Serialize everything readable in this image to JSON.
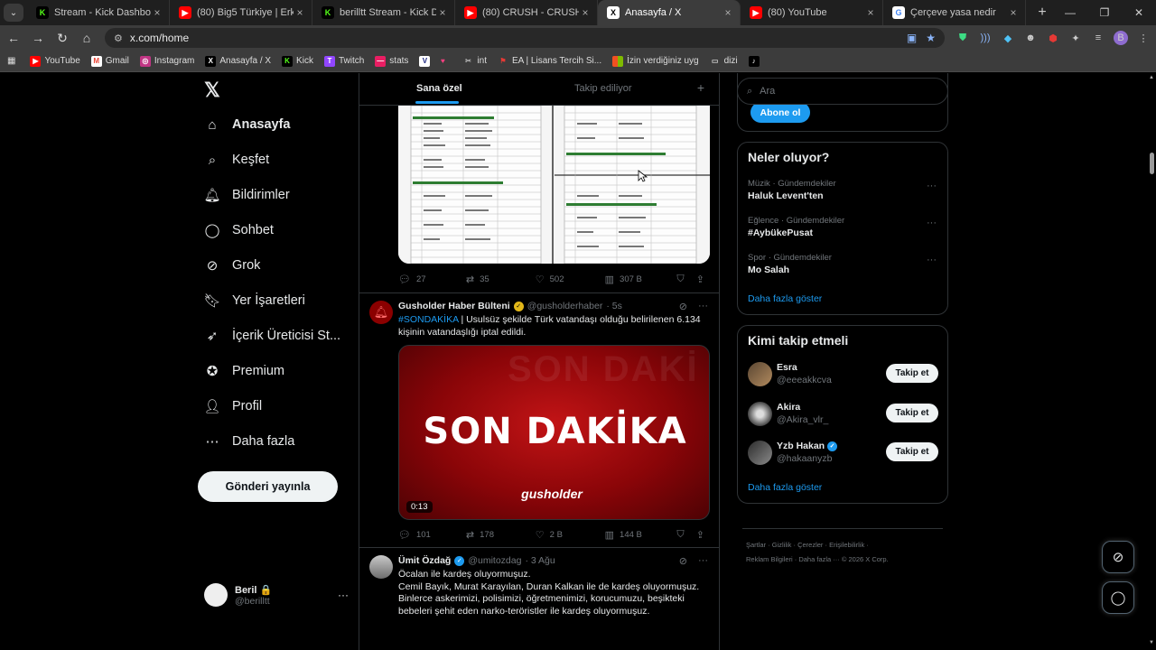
{
  "browser": {
    "tabs": [
      {
        "title": "Stream - Kick Dashboard",
        "icon": "kick-icon",
        "color": "#53fc18"
      },
      {
        "title": "(80) Big5 Türkiye | Erkek Hazırlık",
        "icon": "youtube-icon",
        "color": "#ff0000"
      },
      {
        "title": "berilltt Stream - Kick Dashboard",
        "icon": "kick-icon",
        "color": "#53fc18"
      },
      {
        "title": "(80) CRUSH - CRUSH! | Offi",
        "icon": "youtube-icon",
        "color": "#ff0000"
      },
      {
        "title": "Anasayfa / X",
        "icon": "x-icon",
        "color": "#000000",
        "active": true
      },
      {
        "title": "(80) YouTube",
        "icon": "youtube-icon",
        "color": "#ff0000"
      },
      {
        "title": "Çerçeve yasa nedir",
        "icon": "google-icon",
        "color": "#ffffff"
      }
    ],
    "url": "x.com/home",
    "bookmarks": [
      {
        "label": "YouTube",
        "icon": "youtube-icon"
      },
      {
        "label": "Gmail",
        "icon": "gmail-icon"
      },
      {
        "label": "Instagram",
        "icon": "instagram-icon"
      },
      {
        "label": "Anasayfa / X",
        "icon": "x-icon"
      },
      {
        "label": "Kick",
        "icon": "kick-icon"
      },
      {
        "label": "Twitch",
        "icon": "twitch-icon"
      },
      {
        "label": "stats",
        "icon": "stats-icon"
      },
      {
        "label": "",
        "icon": "v-icon"
      },
      {
        "label": "",
        "icon": "heart-icon"
      },
      {
        "label": "int",
        "icon": "int-icon"
      },
      {
        "label": "EA | Lisans Tercih Si...",
        "icon": "ea-icon"
      },
      {
        "label": "İzin verdiğiniz uyg",
        "icon": "microsoft-icon"
      },
      {
        "label": "dizi",
        "icon": "folder-icon"
      },
      {
        "label": "",
        "icon": "tiktok-icon"
      }
    ]
  },
  "nav": {
    "items": [
      {
        "label": "Anasayfa",
        "icon": "home-icon",
        "bold": true
      },
      {
        "label": "Keşfet",
        "icon": "search-icon"
      },
      {
        "label": "Bildirimler",
        "icon": "bell-icon"
      },
      {
        "label": "Sohbet",
        "icon": "chat-icon"
      },
      {
        "label": "Grok",
        "icon": "grok-icon"
      },
      {
        "label": "Yer İşaretleri",
        "icon": "bookmark-icon"
      },
      {
        "label": "İçerik Üreticisi St...",
        "icon": "rocket-icon"
      },
      {
        "label": "Premium",
        "icon": "premium-icon"
      },
      {
        "label": "Profil",
        "icon": "profile-icon"
      },
      {
        "label": "Daha fazla",
        "icon": "more-circle-icon"
      }
    ],
    "post_button": "Gönderi yayınla",
    "account": {
      "name": "Beril 🔒",
      "handle": "@berilltt"
    }
  },
  "feed": {
    "tabs": [
      "Sana özel",
      "Takip ediliyor"
    ],
    "post1_actions": {
      "replies": "27",
      "reposts": "35",
      "likes": "502",
      "views": "307 B"
    },
    "post2": {
      "name": "Gusholder Haber Bülteni",
      "handle": "@gusholderhaber",
      "time": "· 5s",
      "hashtag": "#SONDAKİKA",
      "text": " | Usulsüz şekilde Türk vatandaşı olduğu belirilenen 6.134 kişinin vatandaşlığı iptal edildi.",
      "video_title": "SON DAKİKA",
      "video_bg_text": "SON DAKİ",
      "video_brand": "gusholder",
      "video_time": "0:13",
      "actions": {
        "replies": "101",
        "reposts": "178",
        "likes": "2 B",
        "views": "144 B"
      }
    },
    "post3": {
      "name": "Ümit Özdağ",
      "handle": "@umitozdag",
      "time": "· 3 Ağu",
      "text_lines": [
        "Öcalan ile kardeş oluyormuşuz.",
        "Cemil Bayık, Murat Karayılan, Duran Kalkan ile de kardeş oluyormuşuz.",
        "Binlerce askerimizi, polisimizi, öğretmenimizi, korucumuzu, beşikteki",
        "bebeleri şehit eden narko-teröristler ile kardeş oluyormuşuz."
      ]
    }
  },
  "right": {
    "search_placeholder": "Ara",
    "premium_subscribe": "Abone ol",
    "trends_title": "Neler oluyor?",
    "trends": [
      {
        "meta": "Müzik · Gündemdekiler",
        "name": "Haluk Levent'ten"
      },
      {
        "meta": "Eğlence · Gündemdekiler",
        "name": "#AybükePusat"
      },
      {
        "meta": "Spor · Gündemdekiler",
        "name": "Mo Salah"
      }
    ],
    "show_more": "Daha fazla göster",
    "who_title": "Kimi takip etmeli",
    "who": [
      {
        "name": "Esra",
        "handle": "@eeeakkcva",
        "verified": false
      },
      {
        "name": "Akira",
        "handle": "@Akira_vlr_",
        "verified": false
      },
      {
        "name": "Yzb Hakan",
        "handle": "@hakaanyzb",
        "verified": true
      }
    ],
    "follow_label": "Takip et",
    "footer_line1": "Şartlar  ·  Gizlilik  ·  Çerezler  ·  Erişilebilirlik  ·",
    "footer_line2": "Reklam Bilgileri  ·  Daha fazla ···  © 2026 X Corp."
  },
  "colors": {
    "accent": "#1d9bf0",
    "verified_gold": "#e2b719",
    "verified_blue": "#1d9bf0"
  }
}
